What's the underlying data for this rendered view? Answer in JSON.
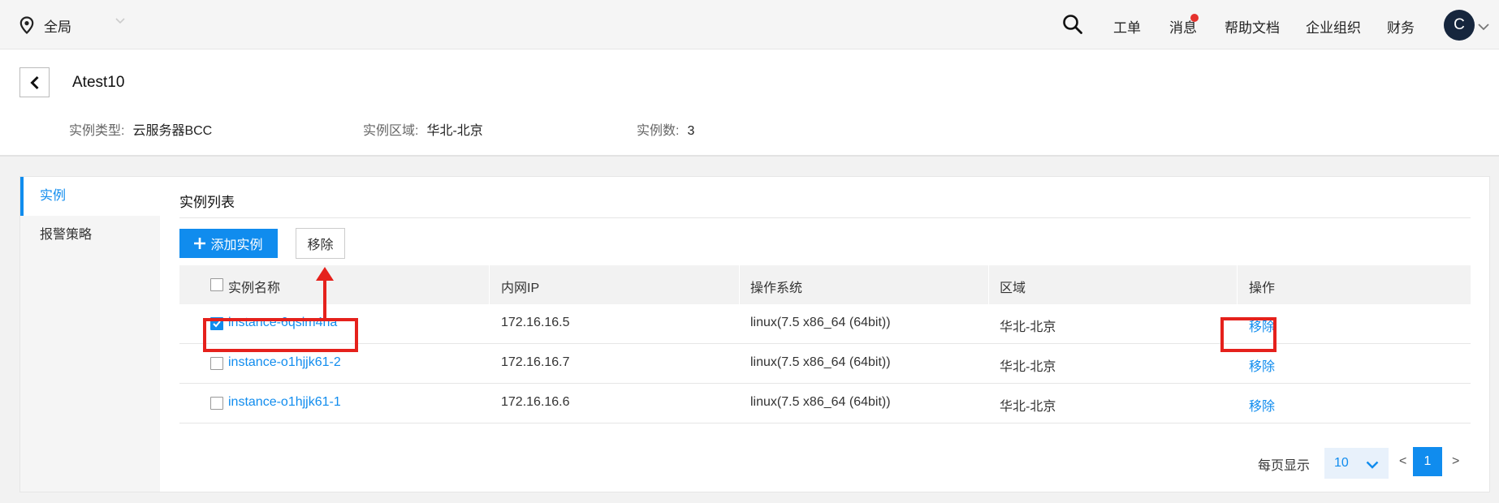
{
  "topbar": {
    "region_label": "全局",
    "nav": [
      "工单",
      "消息",
      "帮助文档",
      "企业组织",
      "财务"
    ],
    "avatar_letter": "C",
    "notification_dot_color": "#e5322d"
  },
  "header": {
    "title": "Atest10",
    "meta": [
      {
        "key": "实例类型:",
        "value": "云服务器BCC"
      },
      {
        "key": "实例区域:",
        "value": "华北-北京"
      },
      {
        "key": "实例数:",
        "value": "3"
      }
    ]
  },
  "sidebar": {
    "items": [
      {
        "label": "实例",
        "active": true
      },
      {
        "label": "报警策略",
        "active": false
      }
    ]
  },
  "section": {
    "title": "实例列表",
    "add_button": "添加实例",
    "remove_button": "移除"
  },
  "table": {
    "columns": [
      "实例名称",
      "内网IP",
      "操作系统",
      "区域",
      "操作"
    ],
    "rows": [
      {
        "name": "instance-6qsim4ha",
        "ip": "172.16.16.5",
        "os": "linux(7.5 x86_64 (64bit))",
        "region": "华北-北京",
        "action": "移除",
        "checked": true
      },
      {
        "name": "instance-o1hjjk61-2",
        "ip": "172.16.16.7",
        "os": "linux(7.5 x86_64 (64bit))",
        "region": "华北-北京",
        "action": "移除",
        "checked": false
      },
      {
        "name": "instance-o1hjjk61-1",
        "ip": "172.16.16.6",
        "os": "linux(7.5 x86_64 (64bit))",
        "region": "华北-北京",
        "action": "移除",
        "checked": false
      }
    ]
  },
  "pager": {
    "per_page_label": "每页显示",
    "per_page": "10",
    "prev": "<",
    "current": "1",
    "next": ">"
  },
  "colors": {
    "accent": "#108cee",
    "annotation": "#e5211c"
  }
}
